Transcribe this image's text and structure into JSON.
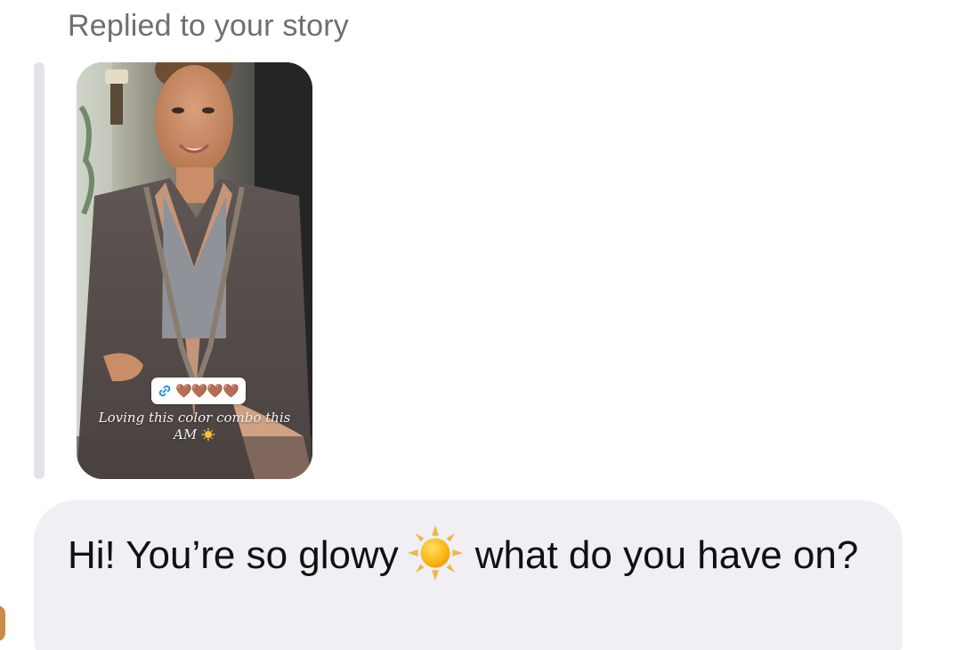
{
  "header": {
    "replied_label": "Replied to your story"
  },
  "story": {
    "link_sticker_icon": "link-icon",
    "link_sticker_emoji": "🤎🤎🤎🤎",
    "caption_line1": "Loving this color combo this",
    "caption_line2": "AM"
  },
  "message": {
    "text_before_emoji": "Hi! You’re so glowy",
    "emoji": "sun-emoji",
    "text_after_emoji": "what do you have on?"
  },
  "colors": {
    "bubble_bg": "#efeff4",
    "reply_bar": "#e3e3e8",
    "label_gray": "#6e6e73",
    "heart_brown": "#6b3e26"
  }
}
